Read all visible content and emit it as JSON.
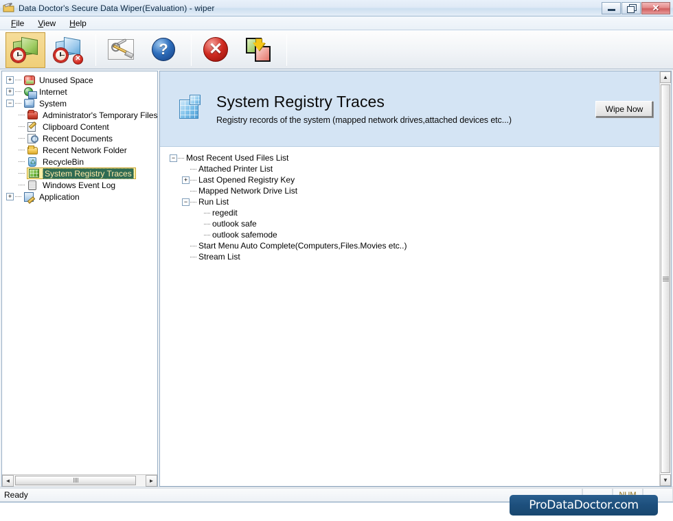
{
  "window": {
    "title": "Data Doctor's Secure Data Wiper(Evaluation) - wiper",
    "app_icon": "wiper-app-icon",
    "minimize_label": "",
    "restore_label": "",
    "close_label": "✕"
  },
  "menu": {
    "items": [
      {
        "label": "File",
        "accel": "F"
      },
      {
        "label": "View",
        "accel": "V"
      },
      {
        "label": "Help",
        "accel": "H"
      }
    ]
  },
  "toolbar": {
    "buttons": [
      {
        "name": "wipe-unused-space-button",
        "icon": "green-folder-clock-icon",
        "pressed": true
      },
      {
        "name": "stop-wipe-button",
        "icon": "blue-folder-clock-delete-icon",
        "pressed": false
      },
      {
        "name": "settings-button",
        "icon": "tools-wrench-screwdriver-icon",
        "pressed": false
      },
      {
        "name": "help-button",
        "icon": "blue-question-mark-icon",
        "pressed": false
      },
      {
        "name": "cancel-button",
        "icon": "red-x-circle-icon",
        "pressed": false
      },
      {
        "name": "exchange-button",
        "icon": "green-red-squares-yellow-arrow-icon",
        "pressed": false
      }
    ]
  },
  "sidebar": {
    "items": [
      {
        "label": "Unused Space",
        "icon": "unused-space-disk-icon",
        "level": 0,
        "expander": "+",
        "selected": false
      },
      {
        "label": "Internet",
        "icon": "internet-globe-icon",
        "level": 0,
        "expander": "+",
        "selected": false
      },
      {
        "label": "System",
        "icon": "system-monitor-icon",
        "level": 0,
        "expander": "-",
        "selected": false
      },
      {
        "label": "Administrator's Temporary Files",
        "icon": "red-folder-icon",
        "level": 1,
        "expander": "",
        "selected": false
      },
      {
        "label": "Clipboard Content",
        "icon": "clipboard-note-pencil-icon",
        "level": 1,
        "expander": "",
        "selected": false
      },
      {
        "label": "Recent Documents",
        "icon": "recent-documents-icon",
        "level": 1,
        "expander": "",
        "selected": false
      },
      {
        "label": "Recent Network Folder",
        "icon": "yellow-open-folder-icon",
        "level": 1,
        "expander": "",
        "selected": false
      },
      {
        "label": "RecycleBin",
        "icon": "recycle-bin-icon",
        "level": 1,
        "expander": "",
        "selected": false
      },
      {
        "label": "System Registry Traces",
        "icon": "registry-cube-icon",
        "level": 1,
        "expander": "",
        "selected": true
      },
      {
        "label": "Windows Event Log",
        "icon": "event-log-icon",
        "level": 1,
        "expander": "",
        "selected": false
      },
      {
        "label": "Application",
        "icon": "application-icon",
        "level": 0,
        "expander": "+",
        "selected": false
      }
    ],
    "hscroll": {
      "left_arrow": "◄",
      "right_arrow": "►"
    }
  },
  "content": {
    "header": {
      "icon": "registry-cube-icon",
      "title": "System Registry Traces",
      "subtitle": "Registry records of the system (mapped network drives,attached devices etc...)",
      "wipe_button": "Wipe Now"
    },
    "tree": [
      {
        "label": "Most Recent Used Files List",
        "level": 0,
        "expander": "-"
      },
      {
        "label": "Attached Printer List",
        "level": 1,
        "expander": ""
      },
      {
        "label": "Last Opened Registry Key",
        "level": 1,
        "expander": "+"
      },
      {
        "label": "Mapped Network Drive List",
        "level": 1,
        "expander": ""
      },
      {
        "label": "Run List",
        "level": 1,
        "expander": "-"
      },
      {
        "label": "regedit",
        "level": 2,
        "expander": ""
      },
      {
        "label": "outlook safe",
        "level": 2,
        "expander": ""
      },
      {
        "label": "outlook safemode",
        "level": 2,
        "expander": ""
      },
      {
        "label": "Start Menu Auto Complete(Computers,Files.Movies etc..)",
        "level": 1,
        "expander": ""
      },
      {
        "label": "Stream List",
        "level": 1,
        "expander": ""
      }
    ],
    "vscroll": {
      "up_arrow": "▲",
      "down_arrow": "▼"
    }
  },
  "statusbar": {
    "message": "Ready",
    "cells": [
      "",
      "NUM",
      ""
    ]
  },
  "brand": {
    "text": "ProDataDoctor.com"
  },
  "colors": {
    "header_panel": "#d4e4f4",
    "selection_bg": "#2f6b53",
    "selection_text": "#ffe9a8",
    "selection_highlight": "#fcf0a8",
    "brand_bg": "#1d4f7c",
    "toolbar_pressed": "#f0cf79"
  }
}
